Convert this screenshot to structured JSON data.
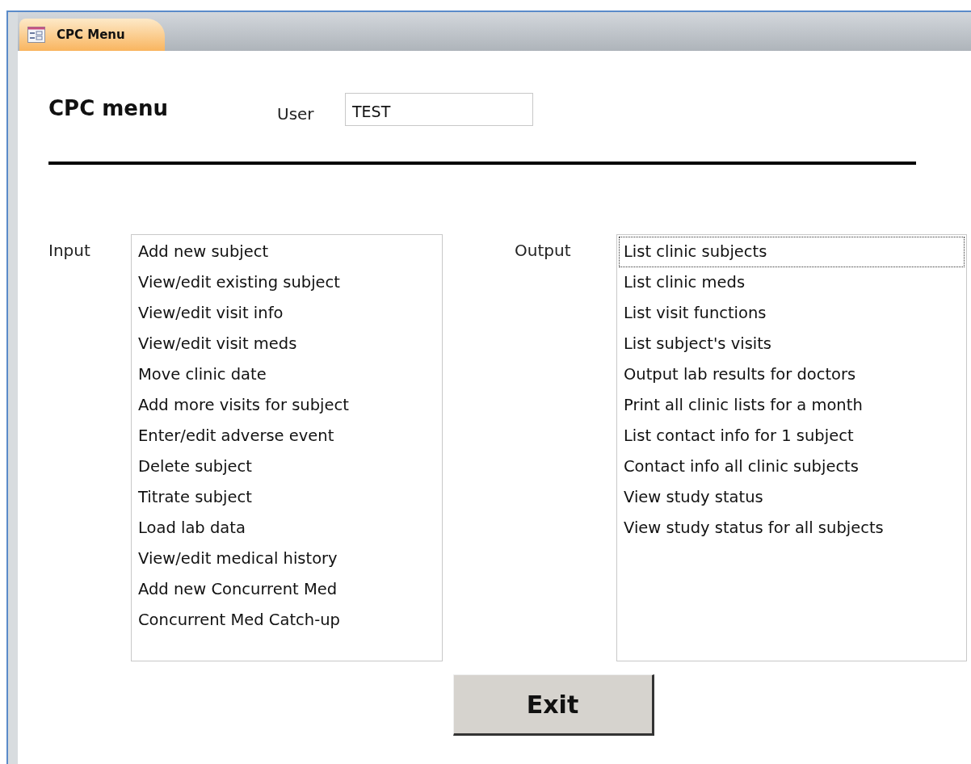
{
  "tab": {
    "label": "CPC Menu",
    "selected": true
  },
  "form": {
    "title": "CPC menu",
    "user": {
      "label": "User",
      "value": "TEST"
    }
  },
  "input": {
    "label": "Input",
    "items": [
      {
        "text": "Add new subject",
        "focused": false
      },
      {
        "text": "View/edit existing subject",
        "focused": false
      },
      {
        "text": "View/edit visit info",
        "focused": false
      },
      {
        "text": "View/edit visit meds",
        "focused": false
      },
      {
        "text": "Move clinic date",
        "focused": false
      },
      {
        "text": "Add more visits for subject",
        "focused": false
      },
      {
        "text": "Enter/edit adverse event",
        "focused": false
      },
      {
        "text": "Delete subject",
        "focused": false
      },
      {
        "text": "Titrate subject",
        "focused": false
      },
      {
        "text": "Load lab data",
        "focused": false
      },
      {
        "text": "View/edit medical history",
        "focused": false
      },
      {
        "text": "Add new Concurrent Med",
        "focused": false
      },
      {
        "text": "Concurrent Med Catch-up",
        "focused": false
      }
    ]
  },
  "output": {
    "label": "Output",
    "items": [
      {
        "text": "List clinic subjects",
        "focused": true
      },
      {
        "text": "List clinic meds",
        "focused": false
      },
      {
        "text": "List visit functions",
        "focused": false
      },
      {
        "text": "List subject's visits",
        "focused": false
      },
      {
        "text": "Output lab results for doctors",
        "focused": false
      },
      {
        "text": "Print all clinic lists for a month",
        "focused": false
      },
      {
        "text": "List contact info for 1 subject",
        "focused": false
      },
      {
        "text": "Contact info all clinic subjects",
        "focused": false
      },
      {
        "text": "View study status",
        "focused": false
      },
      {
        "text": "View study status for all subjects",
        "focused": false
      }
    ]
  },
  "exit_button": "Exit"
}
